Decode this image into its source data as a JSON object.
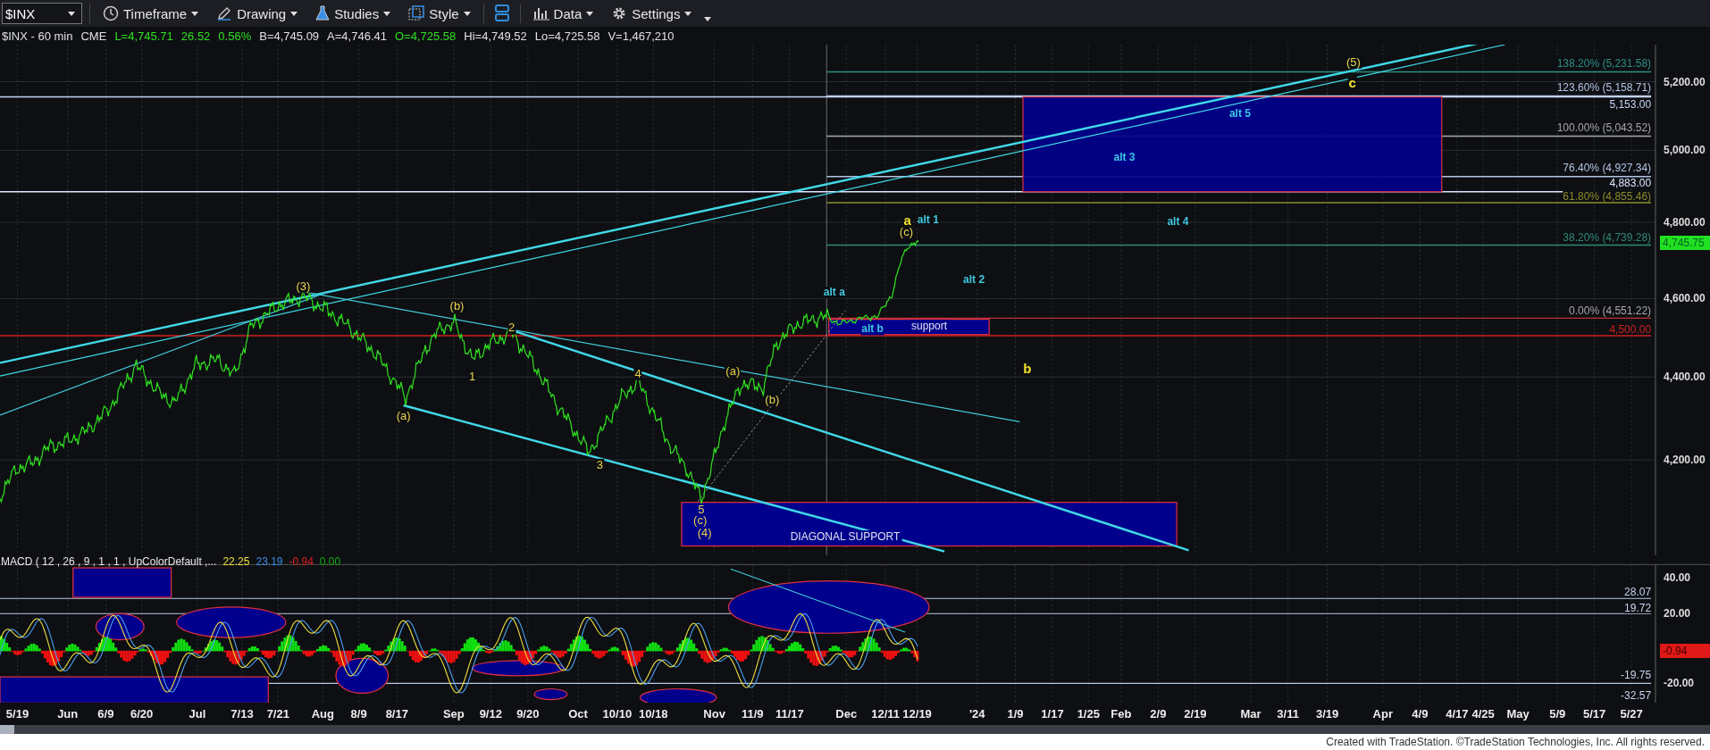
{
  "toolbar": {
    "symbol": "$INX",
    "buttons": [
      {
        "label": "Timeframe"
      },
      {
        "label": "Drawing"
      },
      {
        "label": "Studies"
      },
      {
        "label": "Style"
      },
      {
        "label": "Data"
      },
      {
        "label": "Settings"
      }
    ]
  },
  "quote": {
    "symbol_line": "$INX - 60 min",
    "exchange": "CME",
    "last": "L=4,745.71",
    "change": "26.52",
    "change_pct": "0.56%",
    "bid": "B=4,745.09",
    "ask": "A=4,746.41",
    "open": "O=4,725.58",
    "high": "Hi=4,749.52",
    "low": "Lo=4,725.58",
    "volume": "V=1,467,210"
  },
  "price_chart": {
    "price_axis": [
      "5,200.00",
      "5,000.00",
      "4,800.00",
      "4,600.00",
      "4,400.00",
      "4,200.00"
    ],
    "last_price": "4,745.75",
    "levels": [
      {
        "label": "138.20% (5,231.58)",
        "color": "#2f8f84"
      },
      {
        "label": "123.60% (5,158.71)",
        "color": "#b8c6e6"
      },
      {
        "label": "5,153.00",
        "color": "#c8d6f6"
      },
      {
        "label": "100.00% (5,043.52)",
        "color": "#a8a8a8"
      },
      {
        "label": "76.40% (4,927.34)",
        "color": "#b4c4e4"
      },
      {
        "label": "4,883.00",
        "color": "#dce6ff"
      },
      {
        "label": "61.80% (4,855.46)",
        "color": "#8c8c2c"
      },
      {
        "label": "38.20% (4,739.28)",
        "color": "#2e8a78"
      },
      {
        "label": "0.00% (4,551.22)",
        "color": "#a8a8a8"
      },
      {
        "label": "4,500.00",
        "color": "#d42020"
      }
    ],
    "wave_labels": [
      {
        "text": "(3)",
        "kind": "minor",
        "color": "#e8d44a"
      },
      {
        "text": "(b)",
        "kind": "minor",
        "color": "#e8d44a"
      },
      {
        "text": "2",
        "kind": "minor",
        "color": "#e8d44a"
      },
      {
        "text": "1",
        "kind": "minor",
        "color": "#e8d44a"
      },
      {
        "text": "(a)",
        "kind": "minor",
        "color": "#e8d44a"
      },
      {
        "text": "4",
        "kind": "minor",
        "color": "#e8d44a"
      },
      {
        "text": "3",
        "kind": "minor",
        "color": "#e8d44a"
      },
      {
        "text": "5",
        "kind": "minor",
        "color": "#e8d44a"
      },
      {
        "text": "(c)",
        "kind": "minor",
        "color": "#e8d44a"
      },
      {
        "text": "(4)",
        "kind": "minor",
        "color": "#e8d44a"
      },
      {
        "text": "(a)",
        "kind": "minor",
        "color": "#e8d44a"
      },
      {
        "text": "(b)",
        "kind": "minor",
        "color": "#e8d44a"
      },
      {
        "text": "a",
        "kind": "major",
        "color": "#f2e030"
      },
      {
        "text": "(c)",
        "kind": "minor",
        "color": "#e8d44a"
      },
      {
        "text": "b",
        "kind": "major",
        "color": "#f2e030"
      },
      {
        "text": "(5)",
        "kind": "minor",
        "color": "#e8d44a"
      },
      {
        "text": "c",
        "kind": "major",
        "color": "#f2e030"
      },
      {
        "text": "alt a",
        "kind": "alt",
        "color": "#40c8e0"
      },
      {
        "text": "alt b",
        "kind": "alt",
        "color": "#40c8e0"
      },
      {
        "text": "alt 1",
        "kind": "alt",
        "color": "#40c8e0"
      },
      {
        "text": "alt 2",
        "kind": "alt",
        "color": "#40c8e0"
      },
      {
        "text": "alt 3",
        "kind": "alt",
        "color": "#40c8e0"
      },
      {
        "text": "alt 4",
        "kind": "alt",
        "color": "#40c8e0"
      },
      {
        "text": "alt 5",
        "kind": "alt",
        "color": "#40c8e0"
      }
    ],
    "zone_labels": [
      "support",
      "DIAGONAL SUPPORT"
    ]
  },
  "macd": {
    "title": "MACD ( 12 , 26 , 9 , 1 , 1 , UpColorDefault ,...",
    "values": [
      {
        "text": "22.25",
        "color": "#f0e040"
      },
      {
        "text": "23.19",
        "color": "#3a8ee8"
      },
      {
        "text": "-0.94",
        "color": "#e02020"
      },
      {
        "text": "0.00",
        "color": "#10b010"
      }
    ],
    "axis": [
      "40.00",
      "20.00",
      "-20.00"
    ],
    "levels": [
      "28.07",
      "19.72",
      "-19.75",
      "-32.57"
    ],
    "last_value": "-0.94"
  },
  "time_axis": [
    "5/19",
    "Jun",
    "6/9",
    "6/20",
    "Jul",
    "7/13",
    "7/21",
    "Aug",
    "8/9",
    "8/17",
    "Sep",
    "9/12",
    "9/20",
    "Oct",
    "10/10",
    "10/18",
    "Nov",
    "11/9",
    "11/17",
    "Dec",
    "12/11",
    "12/19",
    "'24",
    "1/9",
    "1/17",
    "1/25",
    "Feb",
    "2/9",
    "2/19",
    "Mar",
    "3/11",
    "3/19",
    "Apr",
    "4/9",
    "4/17",
    "4/25",
    "May",
    "5/9",
    "5/17",
    "5/27"
  ],
  "footer": "Created with TradeStation. ©TradeStation Technologies, Inc. All rights reserved."
}
